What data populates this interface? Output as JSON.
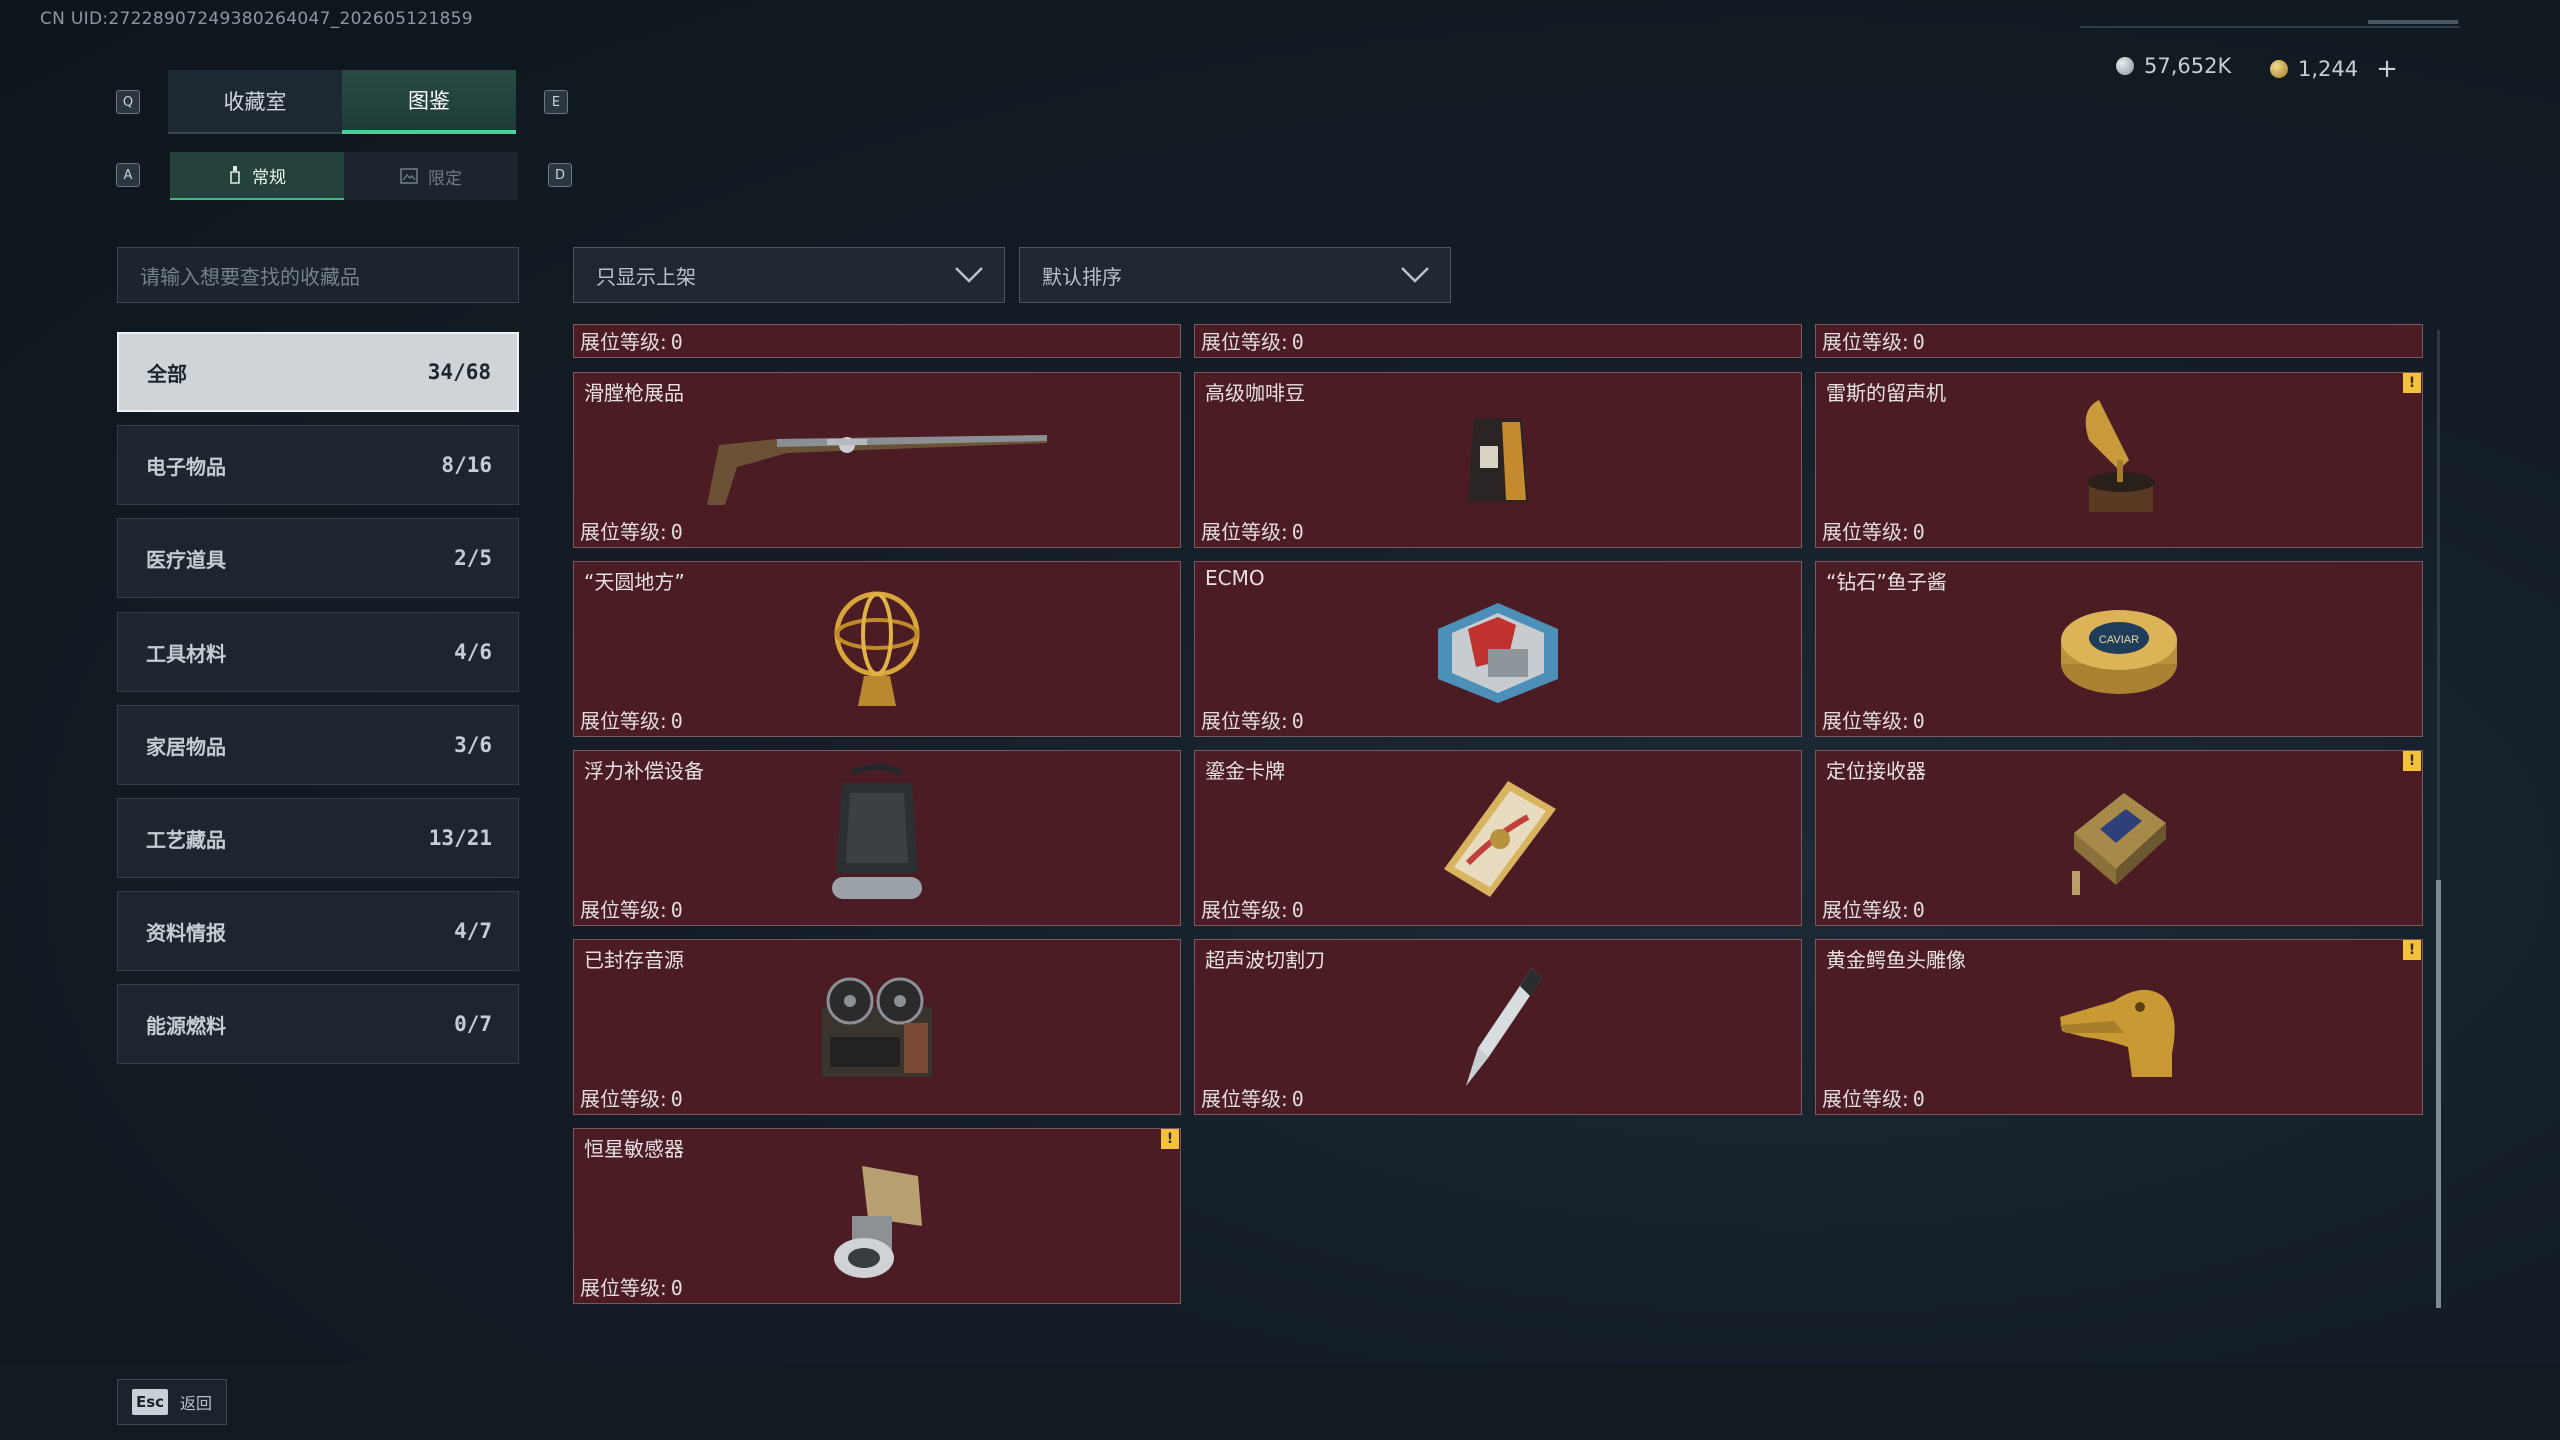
{
  "uid_text": "CN UID:27228907249380264047_202605121859",
  "keys": {
    "q": "Q",
    "e": "E",
    "a": "A",
    "d": "D",
    "esc": "Esc"
  },
  "tabs": [
    {
      "label": "收藏室",
      "active": false
    },
    {
      "label": "图鉴",
      "active": true
    }
  ],
  "subtabs": [
    {
      "label": "常规",
      "icon": "bottle-icon",
      "active": true
    },
    {
      "label": "限定",
      "icon": "frame-icon",
      "active": false
    }
  ],
  "currency": {
    "silver": "57,652K",
    "gold": "1,244",
    "add": "+"
  },
  "search": {
    "placeholder": "请输入想要查找的收藏品"
  },
  "filters": {
    "shelf": "只显示上架",
    "sort": "默认排序"
  },
  "categories": [
    {
      "label": "全部",
      "count": "34/68",
      "active": true
    },
    {
      "label": "电子物品",
      "count": "8/16"
    },
    {
      "label": "医疗道具",
      "count": "2/5"
    },
    {
      "label": "工具材料",
      "count": "4/6"
    },
    {
      "label": "家居物品",
      "count": "3/6"
    },
    {
      "label": "工艺藏品",
      "count": "13/21"
    },
    {
      "label": "资料情报",
      "count": "4/7"
    },
    {
      "label": "能源燃料",
      "count": "0/7"
    }
  ],
  "level_label": "展位等级:",
  "partial_row": [
    {
      "level": "0"
    },
    {
      "level": "0"
    },
    {
      "level": "0"
    }
  ],
  "items": [
    {
      "name": "滑膛枪展品",
      "level": "0",
      "icon": "musket-icon",
      "badge": false
    },
    {
      "name": "高级咖啡豆",
      "level": "0",
      "icon": "coffee-bag-icon",
      "badge": false
    },
    {
      "name": "雷斯的留声机",
      "level": "0",
      "icon": "gramophone-icon",
      "badge": true
    },
    {
      "name": "“天圆地方”",
      "level": "0",
      "icon": "armillary-sphere-icon",
      "badge": false
    },
    {
      "name": "ECMO",
      "level": "0",
      "icon": "ecmo-machine-icon",
      "badge": false
    },
    {
      "name": "“钻石”鱼子酱",
      "level": "0",
      "icon": "caviar-tin-icon",
      "badge": false
    },
    {
      "name": "浮力补偿设备",
      "level": "0",
      "icon": "buoyancy-vest-icon",
      "badge": false
    },
    {
      "name": "鎏金卡牌",
      "level": "0",
      "icon": "gilded-card-icon",
      "badge": false
    },
    {
      "name": "定位接收器",
      "level": "0",
      "icon": "locator-receiver-icon",
      "badge": true
    },
    {
      "name": "已封存音源",
      "level": "0",
      "icon": "reel-recorder-icon",
      "badge": false
    },
    {
      "name": "超声波切割刀",
      "level": "0",
      "icon": "ultrasonic-knife-icon",
      "badge": false
    },
    {
      "name": "黄金鳄鱼头雕像",
      "level": "0",
      "icon": "crocodile-head-icon",
      "badge": true
    },
    {
      "name": "恒星敏感器",
      "level": "0",
      "icon": "star-sensor-icon",
      "badge": true
    }
  ],
  "badge_text": "!",
  "caviar_label": "CAVIAR",
  "back_label": "返回",
  "colors": {
    "accent": "#46d39a",
    "card_bg": "#4b1c24",
    "badge": "#f2c23a"
  }
}
